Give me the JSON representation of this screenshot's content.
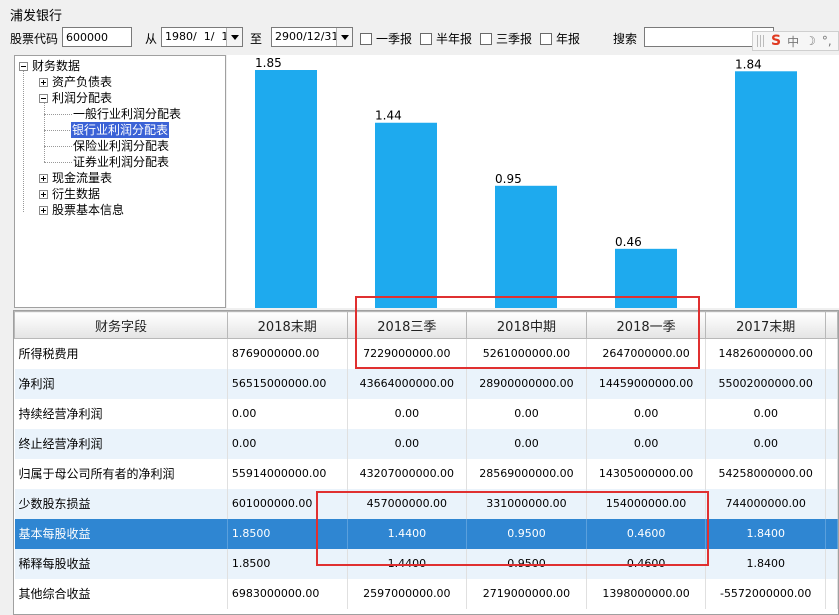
{
  "window": {
    "title": "浦发银行"
  },
  "toolbar": {
    "code_label": "股票代码",
    "code_value": "600000",
    "from_label": "从",
    "from_date": "1980/  1/  1",
    "to_label": "至",
    "to_date": "2900/12/31",
    "checkboxes": [
      "一季报",
      "半年报",
      "三季报",
      "年报"
    ],
    "search_label": "搜索",
    "search_value": ""
  },
  "ime": {
    "logo": "S",
    "mode": "中"
  },
  "tree": {
    "root": "财务数据",
    "items": [
      "资产负债表",
      "利润分配表",
      "一般行业利润分配表",
      "银行业利润分配表",
      "保险业利润分配表",
      "证券业利润分配表",
      "现金流量表",
      "衍生数据",
      "股票基本信息"
    ]
  },
  "chart_data": {
    "type": "bar",
    "categories": [
      "2018末期",
      "2018三季",
      "2018中期",
      "2018一季",
      "2017末期"
    ],
    "values": [
      1.85,
      1.44,
      0.95,
      0.46,
      1.84
    ],
    "ylim": [
      0,
      1.85
    ],
    "bar_color": "#1eaaee",
    "data_labels": [
      "1.85",
      "1.44",
      "0.95",
      "0.46",
      "1.84"
    ]
  },
  "table": {
    "columns": [
      "财务字段",
      "2018末期",
      "2018三季",
      "2018中期",
      "2018一季",
      "2017末期"
    ],
    "rows": [
      {
        "name": "所得税费用",
        "values": [
          "8769000000.00",
          "7229000000.00",
          "5261000000.00",
          "2647000000.00",
          "14826000000.00"
        ]
      },
      {
        "name": "净利润",
        "values": [
          "56515000000.00",
          "43664000000.00",
          "28900000000.00",
          "14459000000.00",
          "55002000000.00"
        ]
      },
      {
        "name": "持续经营净利润",
        "values": [
          "0.00",
          "0.00",
          "0.00",
          "0.00",
          "0.00"
        ]
      },
      {
        "name": "终止经营净利润",
        "values": [
          "0.00",
          "0.00",
          "0.00",
          "0.00",
          "0.00"
        ]
      },
      {
        "name": "归属于母公司所有者的净利润",
        "values": [
          "55914000000.00",
          "43207000000.00",
          "28569000000.00",
          "14305000000.00",
          "54258000000.00"
        ]
      },
      {
        "name": "少数股东损益",
        "values": [
          "601000000.00",
          "457000000.00",
          "331000000.00",
          "154000000.00",
          "744000000.00"
        ]
      },
      {
        "name": "基本每股收益",
        "values": [
          "1.8500",
          "1.4400",
          "0.9500",
          "0.4600",
          "1.8400"
        ]
      },
      {
        "name": "稀释每股收益",
        "values": [
          "1.8500",
          "1.4400",
          "0.9500",
          "0.4600",
          "1.8400"
        ]
      },
      {
        "name": "其他综合收益",
        "values": [
          "6983000000.00",
          "2597000000.00",
          "2719000000.00",
          "1398000000.00",
          "-5572000000.00"
        ]
      }
    ],
    "selected_row": 6
  },
  "colors": {
    "selection": "#2f86d2",
    "alt_row": "#eaf3fb",
    "annotation": "#e03030"
  }
}
